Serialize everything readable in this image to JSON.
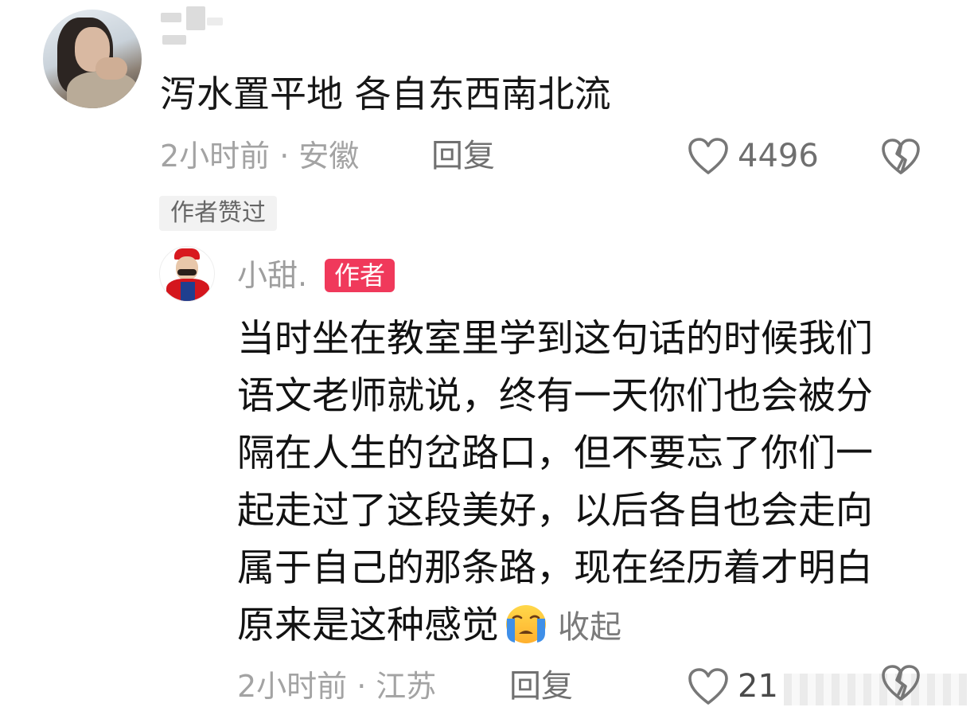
{
  "comment": {
    "text": "泻水置平地 各自东西南北流",
    "time": "2小时前",
    "separator": "·",
    "location": "安徽",
    "reply_label": "回复",
    "like_count": "4496",
    "author_liked_tag": "作者赞过"
  },
  "reply": {
    "username": "小甜.",
    "author_badge": "作者",
    "lines": [
      "当时坐在教室里学到这句话的时候我们",
      "语文老师就说，终有一天你们也会被分",
      "隔在人生的岔路口，但不要忘了你们一",
      "起走过了这段美好，以后各自也会走向",
      "属于自己的那条路，现在经历着才明白",
      "原来是这种感觉"
    ],
    "emoji_icon": "crying-face-emoji",
    "collapse_label": "收起",
    "time": "2小时前",
    "separator": "·",
    "location": "江苏",
    "reply_label": "回复",
    "like_count": "21"
  },
  "icons": {
    "like": "heart-outline-icon",
    "dislike": "broken-heart-icon"
  },
  "colors": {
    "author_badge_bg": "#f0395b",
    "meta_text": "#a3a3a3",
    "tag_bg": "#f2f2f2"
  }
}
